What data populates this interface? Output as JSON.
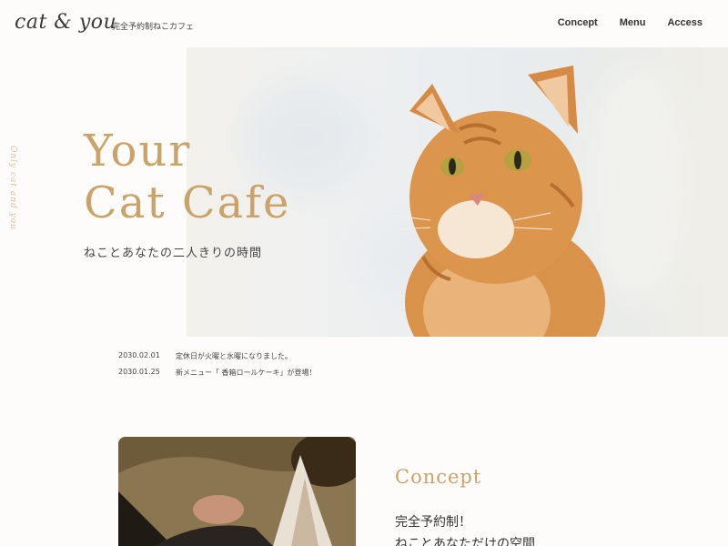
{
  "header": {
    "logo": "cat & you",
    "tagline": "完全予約制ねこカフェ",
    "nav": [
      "Concept",
      "Menu",
      "Access"
    ]
  },
  "side_text": "Only cat and you",
  "hero": {
    "title_line1": "Your",
    "title_line2": "Cat Cafe",
    "subtitle": "ねことあなたの二人きりの時間"
  },
  "news": [
    {
      "date": "2030.02.01",
      "text": "定休日が火曜と水曜になりました。"
    },
    {
      "date": "2030.01.25",
      "text": "新メニュー「 香箱ロールケーキ」が登場！"
    }
  ],
  "concept": {
    "title": "Concept",
    "line1": "完全予約制！",
    "line2": "ねことあなただけの空間"
  },
  "colors": {
    "accent": "#c9a36a",
    "background": "#fdfcfa"
  }
}
